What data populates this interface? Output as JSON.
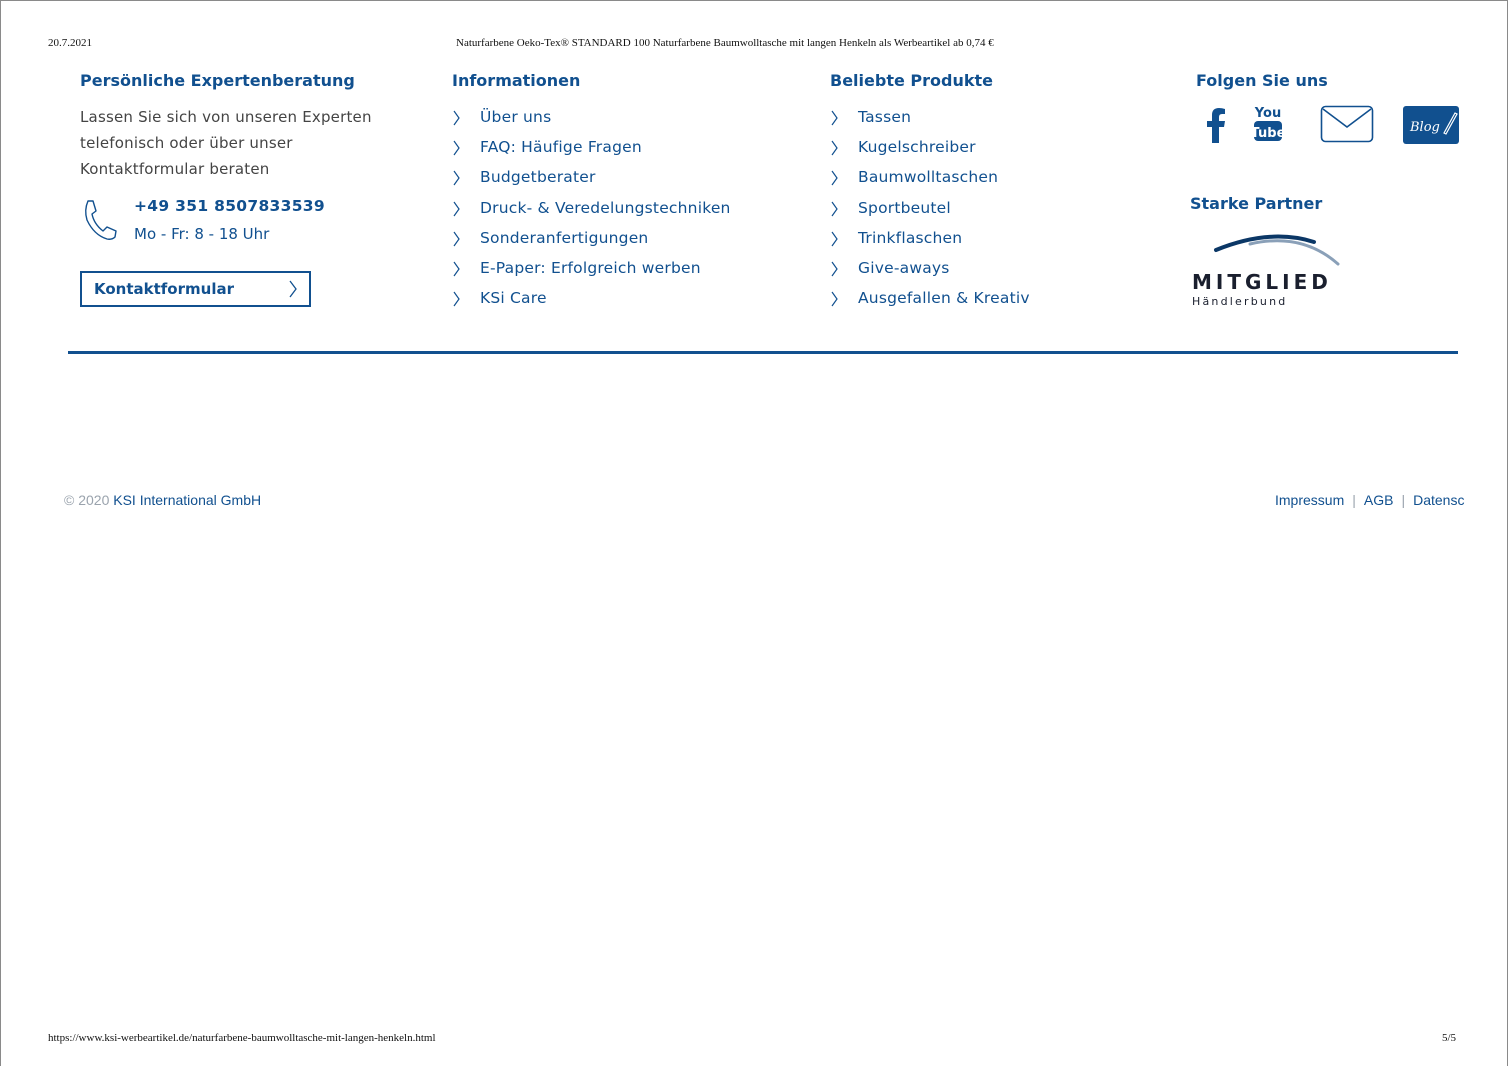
{
  "print_header": {
    "date": "20.7.2021",
    "title": "Naturfarbene Oeko-Tex® STANDARD 100 Naturfarbene Baumwolltasche mit langen Henkeln als Werbeartikel ab 0,74 €"
  },
  "print_footer": {
    "url": "https://www.ksi-werbeartikel.de/naturfarbene-baumwolltasche-mit-langen-henkeln.html",
    "page": "5/5"
  },
  "consulting": {
    "heading": "Persönliche Expertenberatung",
    "intro": "Lassen Sie sich von unseren Experten telefonisch oder über unser Kontaktformular beraten",
    "phone": "+49 351 8507833539",
    "hours": "Mo - Fr: 8 - 18 Uhr",
    "contact_button": "Kontaktformular",
    "icons": [
      "phone-icon",
      "chevron-right-icon"
    ]
  },
  "information": {
    "heading": "Informationen",
    "items": [
      "Über uns",
      "FAQ: Häufige Fragen",
      "Budgetberater",
      "Druck- & Veredelungstechniken",
      "Sonderanfertigungen",
      "E-Paper: Erfolgreich werben",
      "KSi Care"
    ]
  },
  "products": {
    "heading": "Beliebte Produkte",
    "items": [
      "Tassen",
      "Kugelschreiber",
      "Baumwolltaschen",
      "Sportbeutel",
      "Trinkflaschen",
      "Give-aways",
      "Ausgefallen & Kreativ"
    ]
  },
  "follow": {
    "heading": "Folgen Sie uns",
    "icons": [
      "facebook-icon",
      "youtube-icon",
      "mail-icon",
      "blog-icon"
    ],
    "youtube_top": "You",
    "youtube_bottom": "Tube",
    "blog_label": "Blog"
  },
  "partners": {
    "heading": "Starke Partner",
    "badge_title": "MITGLIED",
    "badge_subtitle": "Händlerbund"
  },
  "footer": {
    "copyright_prefix": "© 2020",
    "company": "KSI International GmbH",
    "legal_links": [
      "Impressum",
      "AGB",
      "Datenschutz"
    ]
  },
  "colors": {
    "brand_blue": "#11508f",
    "text_gray": "#444444",
    "muted_gray": "#9aa3ad"
  }
}
